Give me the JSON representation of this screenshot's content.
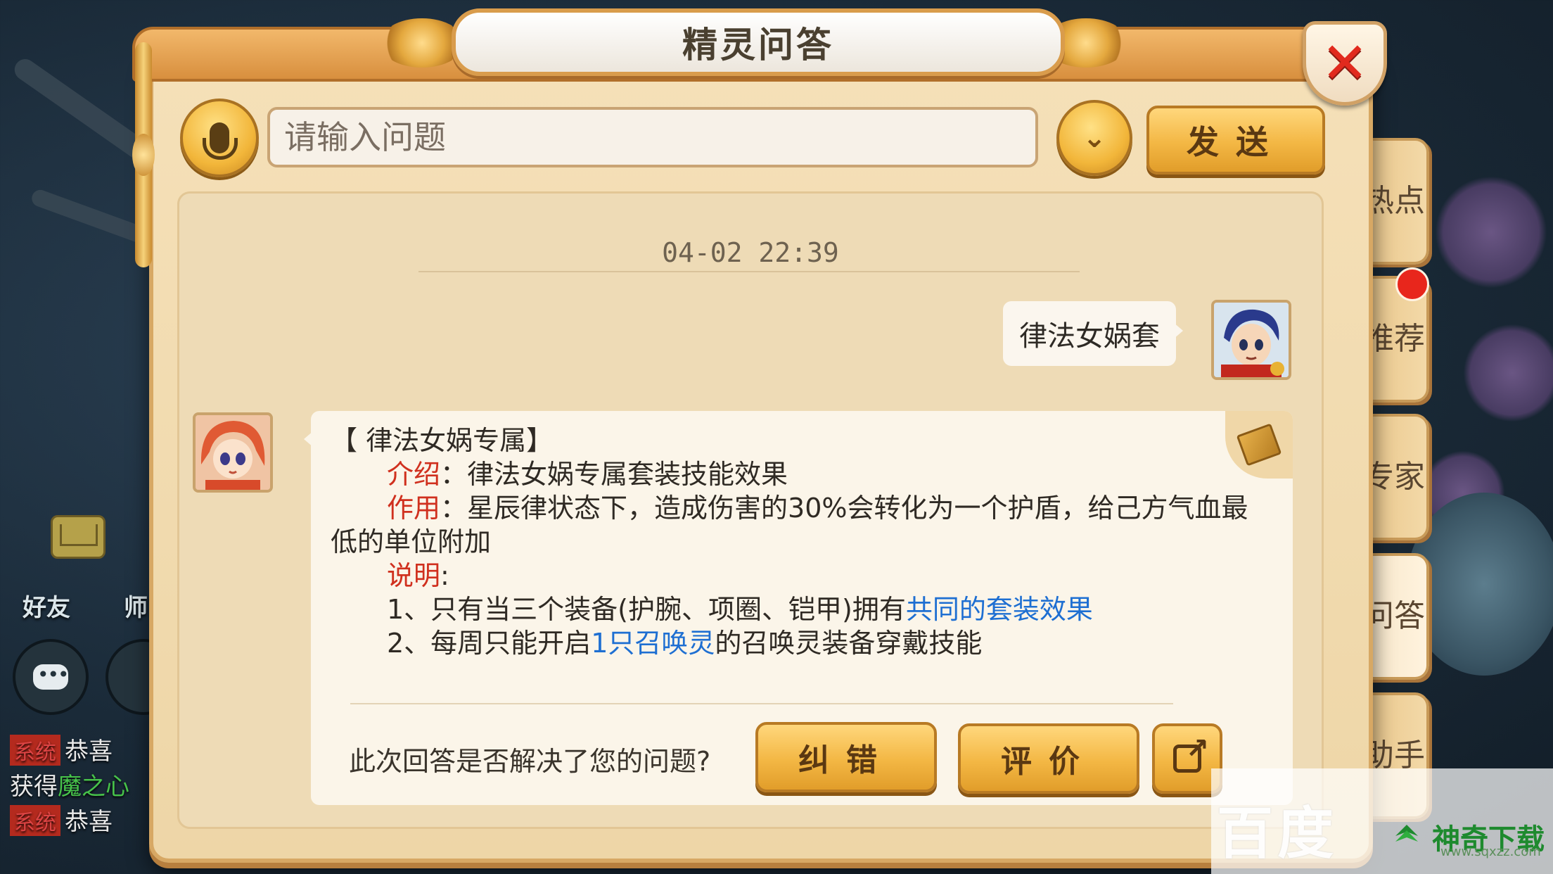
{
  "window": {
    "title": "精灵问答",
    "close_label": "✕"
  },
  "input_row": {
    "placeholder": "请输入问题",
    "dropdown_icon": "chevron-down",
    "send_label": "发送"
  },
  "chat": {
    "timestamp": "04-02 22:39",
    "user_message": "律法女娲套",
    "answer": {
      "heading": "【 律法女娲专属】",
      "intro_label": "介绍",
      "intro_text": "律法女娲专属套装技能效果",
      "effect_label": "作用",
      "effect_text": "星辰律状态下，造成伤害的30%会转化为一个护盾，给己方气血最低的单位附加",
      "note_label": "说明",
      "note_1_prefix": "1、只有当三个装备(护腕、项圈、铠甲)拥有",
      "note_1_link": "共同的套装效果",
      "note_2_prefix": "2、每周只能开启",
      "note_2_link": "1只召唤灵",
      "note_2_suffix": "的召唤灵装备穿戴技能"
    },
    "feedback_question": "此次回答是否解决了您的问题?",
    "correct_label": "纠错",
    "rate_label": "评价"
  },
  "side_tabs": [
    {
      "label": "热点"
    },
    {
      "label": "推荐"
    },
    {
      "label": "专家"
    },
    {
      "label": "问答"
    },
    {
      "label": "助手"
    }
  ],
  "hud": {
    "friends_label": "好友",
    "master_label": "师",
    "chat_lines": [
      {
        "tag": "系统",
        "text": "恭喜"
      },
      {
        "prefix": "获得",
        "highlight": "魔之心"
      },
      {
        "tag": "系统",
        "text": "恭喜"
      }
    ]
  },
  "watermark": {
    "baidu": "百度",
    "brand": "神奇下载",
    "url": "www.sqxzz.com"
  },
  "colors": {
    "panel_bg": "#f5e0b8",
    "gold_button": "#f3b744",
    "label_red": "#d0301e",
    "link_blue": "#1e6fd2",
    "close_red": "#e12a1e"
  }
}
